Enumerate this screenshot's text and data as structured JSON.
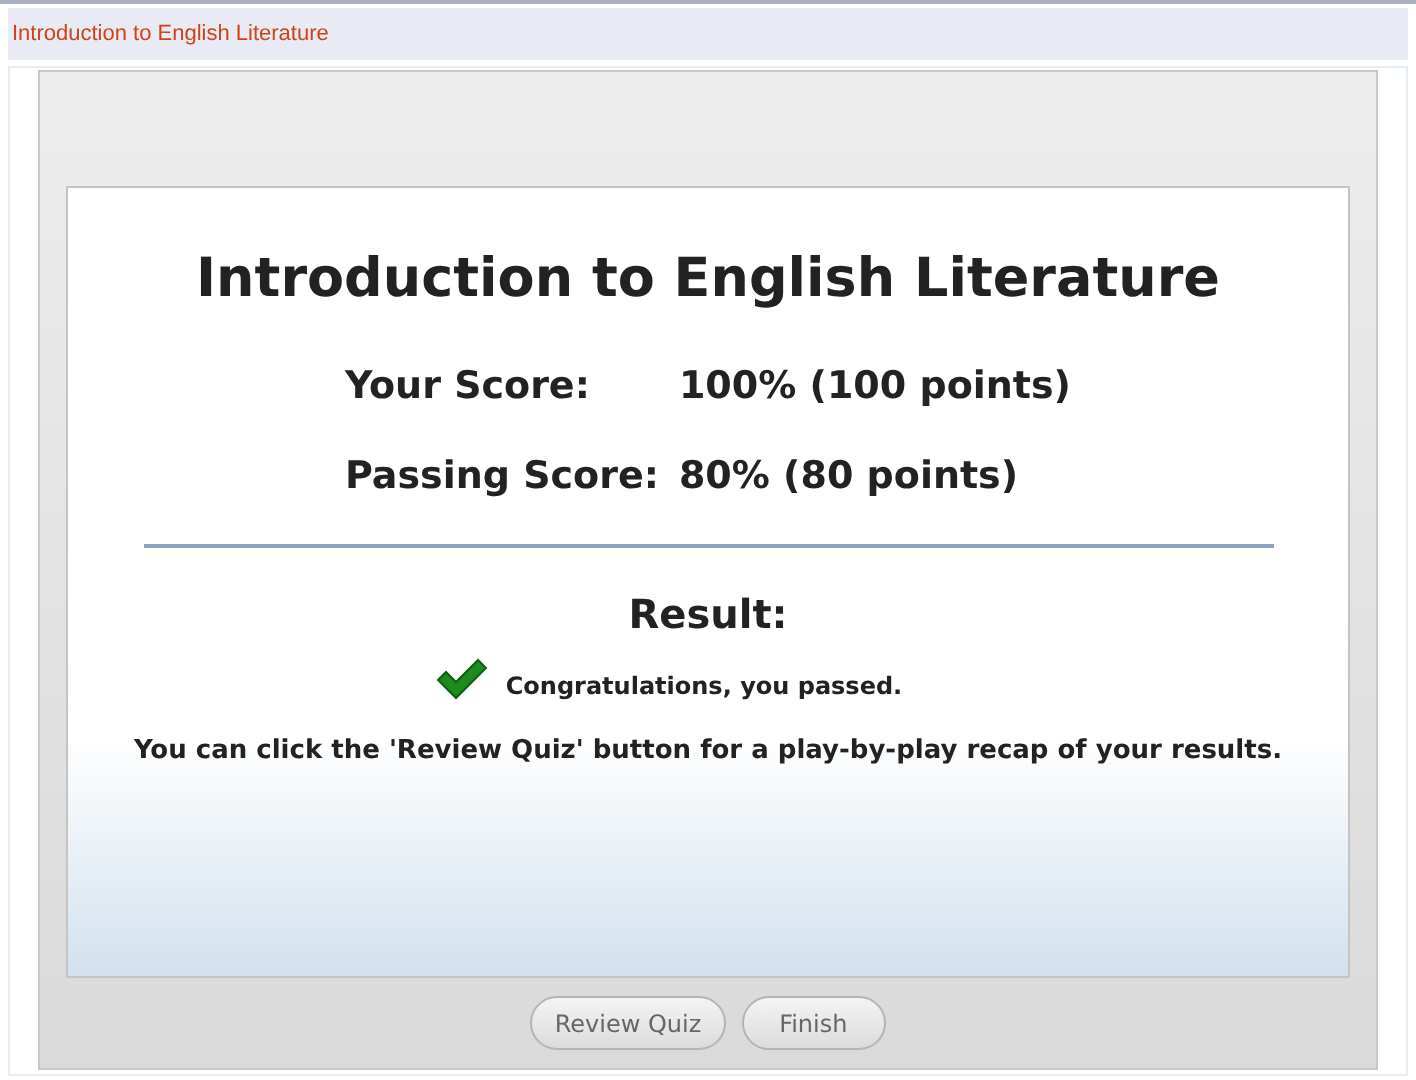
{
  "header": {
    "title": "Introduction to English Literature"
  },
  "quiz": {
    "title": "Introduction to English Literature",
    "scores": [
      {
        "label": "Your Score:",
        "value": "100% (100 points)"
      },
      {
        "label": "Passing Score:",
        "value": "80% (80 points)"
      }
    ],
    "result_label": "Result:",
    "passed": true,
    "result_message": "Congratulations, you passed.",
    "hint": "You can click the 'Review Quiz' button for a play-by-play recap of your results."
  },
  "buttons": [
    "Review Quiz",
    "Finish"
  ]
}
